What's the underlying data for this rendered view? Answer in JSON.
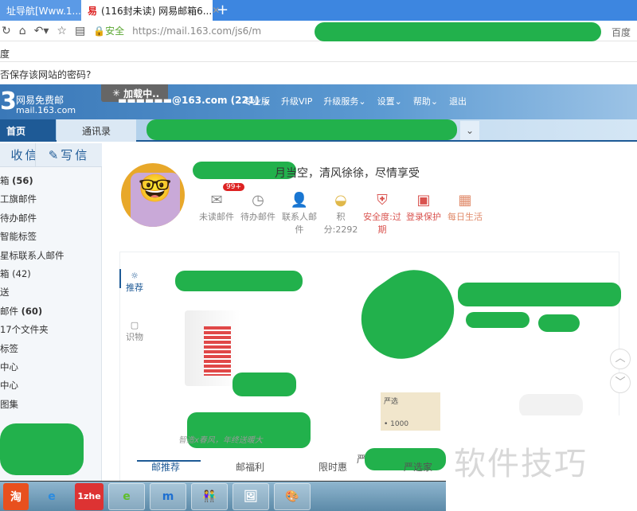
{
  "browser": {
    "tabs": [
      {
        "label": "址导航[Www.1..."
      },
      {
        "label": "(116封未读) 网易邮箱6...",
        "favicon": "163-icon"
      }
    ],
    "security_label": "安全",
    "url": "https://mail.163.com/js6/m",
    "search_engine": "百度",
    "row2_text": "度",
    "password_prompt": "否保存该网站的密码?"
  },
  "mail": {
    "logo_digit": "3",
    "logo_name": "网易免费邮",
    "logo_domain": "mail.163.com",
    "loading": "加载中..",
    "account": "@163.com (221)",
    "top_menu": [
      "专业版",
      "升级VIP",
      "升级服务",
      "设置",
      "帮助",
      "退出"
    ],
    "nav_tabs": [
      "首页",
      "通讯录"
    ],
    "receive": "收信",
    "compose": "写信",
    "folders": [
      {
        "label": "箱",
        "count": "(56)",
        "bold": true
      },
      {
        "label": "工旗邮件"
      },
      {
        "label": "待办邮件"
      },
      {
        "label": "智能标签"
      },
      {
        "label": "星标联系人邮件"
      },
      {
        "label": "箱",
        "count": "(42)"
      },
      {
        "label": "送"
      },
      {
        "label": "邮件",
        "count": "(60)",
        "bold": true
      },
      {
        "label": "17个文件夹"
      },
      {
        "label": "标签"
      },
      {
        "label": "中心"
      },
      {
        "label": "中心"
      },
      {
        "label": "图集"
      }
    ],
    "greeting": "月当空，清风徐徐，尽情享受",
    "badge": "99+",
    "quick": [
      {
        "label": "未读邮件",
        "icon": "envelope-icon",
        "color": "#888888"
      },
      {
        "label": "待办邮件",
        "icon": "clock-icon",
        "color": "#888888"
      },
      {
        "label": "联系人邮件",
        "icon": "contact-star-icon",
        "color": "#888888"
      },
      {
        "label": "积分:2292",
        "icon": "gold-ingot-icon",
        "color": "#888888"
      },
      {
        "label": "安全度:过期",
        "icon": "shield-icon",
        "color": "#d9534f"
      },
      {
        "label": "登录保护",
        "icon": "lock-box-icon",
        "color": "#d9534f"
      },
      {
        "label": "每日生活",
        "icon": "calendar-icon",
        "color": "#e08a6a"
      }
    ],
    "side_tabs": [
      "推荐",
      "识物"
    ],
    "promo_caption": "智造x春风，年终送暖大",
    "card_text": "• 1000",
    "card_brand": "严选",
    "bottom_prefix": "严",
    "bottom_tabs": [
      "邮推荐",
      "邮福利",
      "限时惠",
      "严选家"
    ]
  },
  "taskbar": [
    "淘",
    "e",
    "1zhe",
    "e",
    "m",
    "👫",
    "🖼",
    "🎨"
  ],
  "watermark": "软件技巧"
}
